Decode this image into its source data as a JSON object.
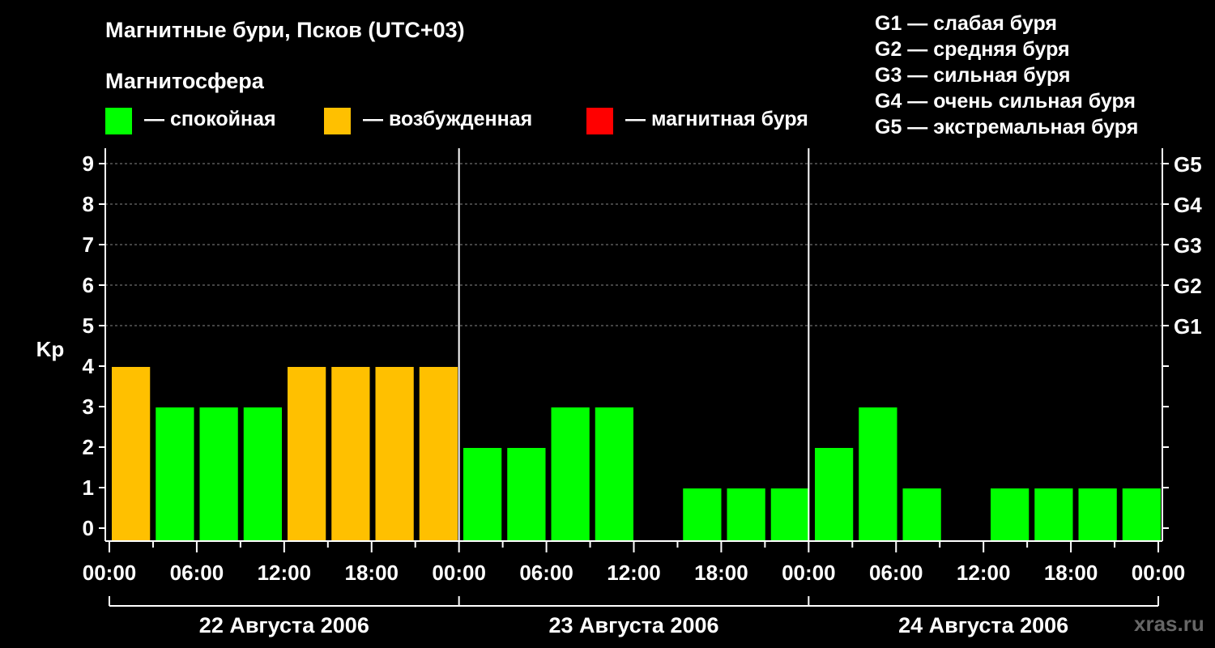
{
  "header": {
    "title": "Магнитные бури, Псков (UTC+03)",
    "subtitle": "Магнитосфера",
    "legend": [
      {
        "color": "#00ff00",
        "label": "— спокойная"
      },
      {
        "color": "#ffc000",
        "label": "— возбужденная"
      },
      {
        "color": "#ff0000",
        "label": "— магнитная буря"
      }
    ],
    "g_scale": [
      "G1 — слабая буря",
      "G2 — средняя буря",
      "G3 — сильная буря",
      "G4 — очень сильная буря",
      "G5 — экстремальная буря"
    ]
  },
  "watermark": "xras.ru",
  "chart_data": {
    "type": "bar",
    "ylabel": "Kp",
    "ylim": [
      0,
      9
    ],
    "y_ticks": [
      "0",
      "1",
      "2",
      "3",
      "4",
      "5",
      "6",
      "7",
      "8",
      "9"
    ],
    "right_ticks": [
      {
        "kp": 5,
        "label": "G1"
      },
      {
        "kp": 6,
        "label": "G2"
      },
      {
        "kp": 7,
        "label": "G3"
      },
      {
        "kp": 8,
        "label": "G4"
      },
      {
        "kp": 9,
        "label": "G5"
      }
    ],
    "x_tick_labels": [
      "00:00",
      "06:00",
      "12:00",
      "18:00",
      "00:00",
      "06:00",
      "12:00",
      "18:00",
      "00:00",
      "06:00",
      "12:00",
      "18:00",
      "00:00"
    ],
    "days": [
      "22 Августа 2006",
      "23 Августа 2006",
      "24 Августа 2006"
    ],
    "interval_hours": 3,
    "kp_values": [
      4,
      3,
      3,
      3,
      4,
      4,
      4,
      4,
      2,
      2,
      3,
      3,
      0,
      1,
      1,
      1,
      2,
      3,
      1,
      0,
      1,
      1,
      1,
      1
    ],
    "bar_status": [
      "excited",
      "quiet",
      "quiet",
      "quiet",
      "excited",
      "excited",
      "excited",
      "excited",
      "quiet",
      "quiet",
      "quiet",
      "quiet",
      "quiet",
      "quiet",
      "quiet",
      "quiet",
      "quiet",
      "quiet",
      "quiet",
      "quiet",
      "quiet",
      "quiet",
      "quiet",
      "quiet"
    ],
    "colors": {
      "quiet": "#00ff00",
      "excited": "#ffc000",
      "storm": "#ff0000"
    },
    "grid": "dashed horizontal at Kp 5-9"
  }
}
